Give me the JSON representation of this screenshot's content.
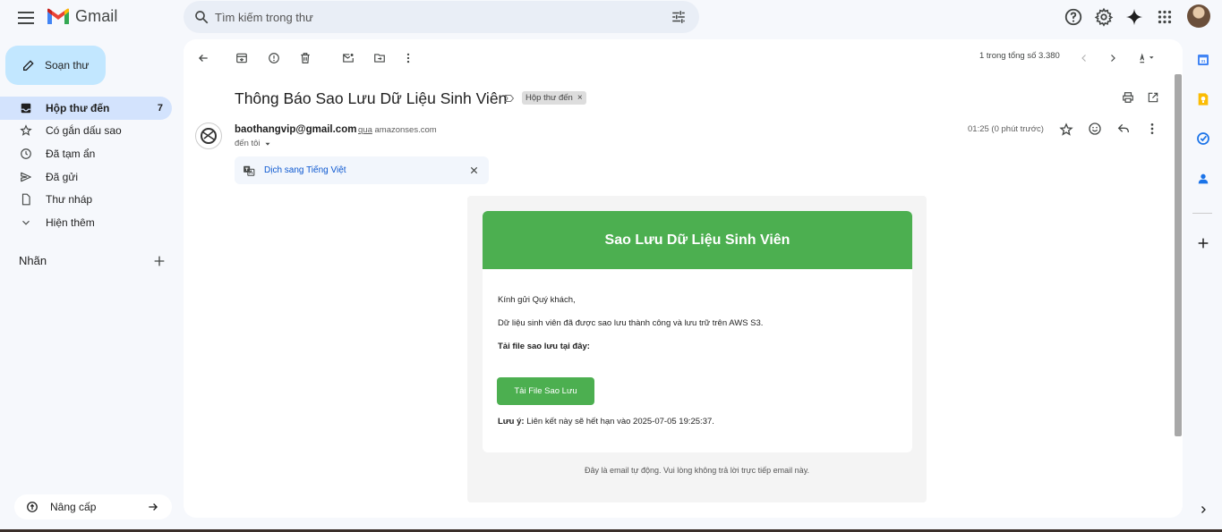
{
  "app": {
    "name": "Gmail",
    "search_placeholder": "Tìm kiếm trong thư"
  },
  "sidebar": {
    "compose_label": "Soạn thư",
    "items": [
      {
        "label": "Hộp thư đến",
        "count": "7",
        "icon": "inbox-icon",
        "active": true
      },
      {
        "label": "Có gắn dấu sao",
        "icon": "star-icon"
      },
      {
        "label": "Đã tạm ẩn",
        "icon": "clock-icon"
      },
      {
        "label": "Đã gửi",
        "icon": "send-icon"
      },
      {
        "label": "Thư nháp",
        "icon": "draft-icon"
      },
      {
        "label": "Hiện thêm",
        "icon": "chevron-down-icon"
      }
    ],
    "labels_heading": "Nhãn",
    "upgrade_label": "Nâng cấp"
  },
  "toolbar": {
    "page_count": "1 trong tổng số 3.380"
  },
  "message": {
    "subject": "Thông Báo Sao Lưu Dữ Liệu Sinh Viên",
    "label_chip": "Hộp thư đến",
    "label_chip_close": "×",
    "sender_email": "baothangvip@gmail.com",
    "via_word": "qua",
    "via_domain": "amazonses.com",
    "recipient": "đến tôi",
    "time": "01:25 (0 phút trước)",
    "translate_link": "Dịch sang Tiếng Việt"
  },
  "email": {
    "header_title": "Sao Lưu Dữ Liệu Sinh Viên",
    "greeting": "Kính gửi Quý khách,",
    "line1": "Dữ liệu sinh viên đã được sao lưu thành công và lưu trữ trên AWS S3.",
    "download_heading": "Tải file sao lưu tại đây:",
    "download_button": "Tải File Sao Lưu",
    "note_label": "Lưu ý:",
    "note_text": " Liên kết này sẽ hết hạn vào 2025-07-05 19:25:37.",
    "footer": "Đây là email tự động. Vui lòng không trả lời trực tiếp email này."
  },
  "colors": {
    "accent_green": "#4caf50",
    "compose_bg": "#c2e7ff",
    "active_nav_bg": "#d3e3fd",
    "link_blue": "#0b57d0"
  }
}
